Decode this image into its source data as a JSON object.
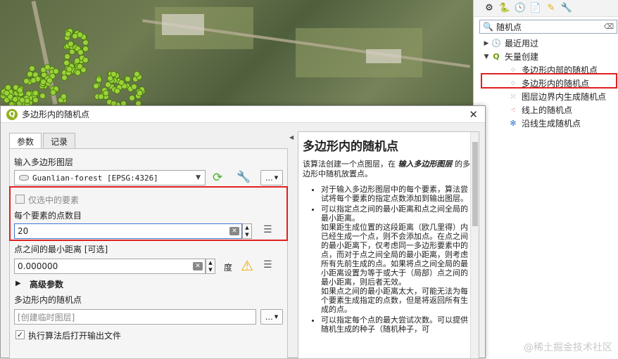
{
  "toolbox": {
    "search_value": "随机点",
    "tree": [
      {
        "label": "最近用过",
        "icon": "clock-icon",
        "level": 1,
        "expanded": false
      },
      {
        "label": "矢量创建",
        "icon": "qgis-q-icon",
        "level": 1,
        "expanded": true
      },
      {
        "label": "多边形内部的随机点",
        "icon": "random-points-icon",
        "level": 2
      },
      {
        "label": "多边形内的随机点",
        "icon": "random-points-icon",
        "level": 2,
        "highlighted": true
      },
      {
        "label": "图层边界内生成随机点",
        "icon": "random-points-icon",
        "level": 2
      },
      {
        "label": "线上的随机点",
        "icon": "random-points-icon",
        "level": 2
      },
      {
        "label": "沿线生成随机点",
        "icon": "random-points-icon",
        "level": 2
      }
    ]
  },
  "dialog": {
    "title": "多边形内的随机点",
    "tabs": [
      "参数",
      "记录"
    ],
    "input_layer_label": "输入多边形图层",
    "input_layer_value": "Guanlian-forest [EPSG:4326]",
    "selected_only_label": "仅选中的要素",
    "points_label": "每个要素的点数目",
    "points_value": "20",
    "min_dist_label": "点之间的最小距离 [可选]",
    "min_dist_value": "0.000000",
    "unit_label": "度",
    "advanced_label": "高级参数",
    "output_label": "多边形内的随机点",
    "output_placeholder": "[创建临时图层]",
    "open_after_label": "执行算法后打开输出文件",
    "more_label": "…"
  },
  "help": {
    "title": "多边形内的随机点",
    "intro_pre": "该算法创建一个点图层，在",
    "intro_bold": "输入多边形图层",
    "intro_post": "的多边形中随机放置点。",
    "b1": "对于输入多边形图层中的每个要素，算法尝试将每个要素的指定点数添加到输出图层。",
    "b2a": "可以指定点之间的最小距离和点之间全局的最小距离。",
    "b2b": "如果距生成位置的这段距离（欧几里得）内已经生成一个点，则不会添加点。在点之间的最小距离下，仅考虑同一多边形要素中的点，而对于点之间全局的最小距离，则考虑所有先前生成的点。如果将点之间全局的最小距离设置为等于或大于（局部）点之间的最小距离，则后者无效。",
    "b2c": "如果点之间的最小距离太大，可能无法为每个要素生成指定的点数，但是将返回所有生成的点。",
    "b3": "可以指定每个点的最大尝试次数。可以提供随机生成的种子（随机种子，可"
  },
  "watermark": "@稀土掘金技术社区"
}
